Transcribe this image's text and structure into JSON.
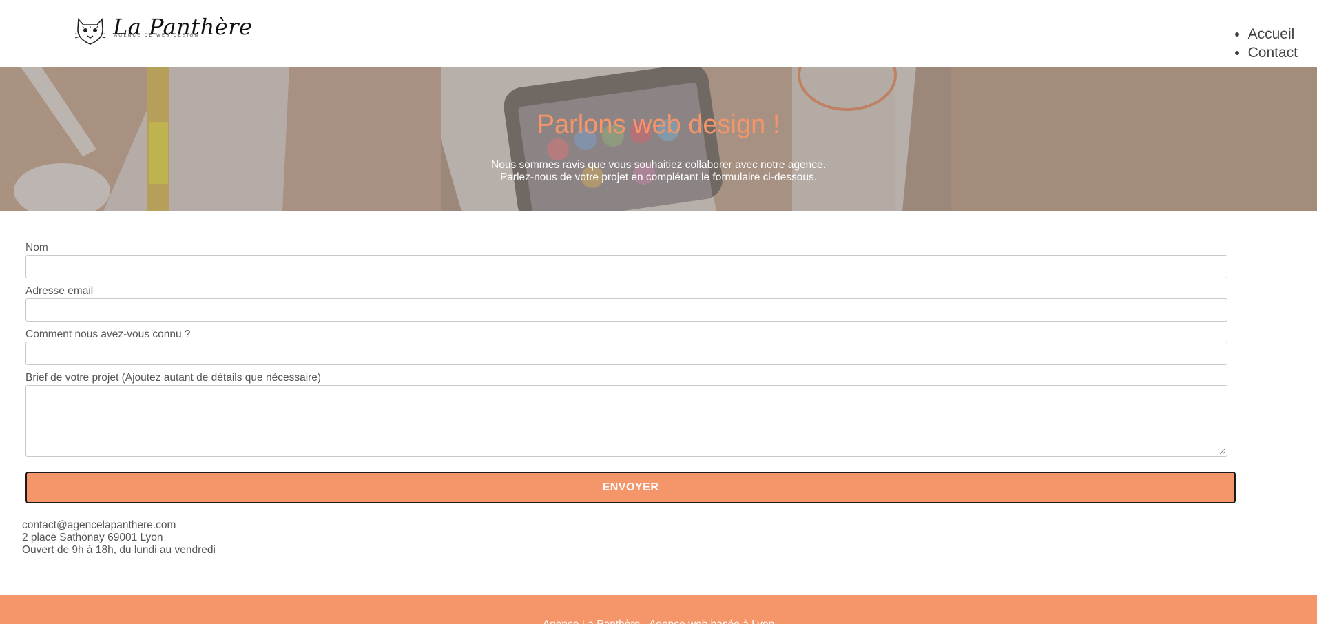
{
  "brand": {
    "name": "La Panthère",
    "tagline": "AGENCE DE WEB DESIGN"
  },
  "nav": {
    "items": [
      {
        "label": "Accueil"
      },
      {
        "label": "Contact"
      }
    ]
  },
  "hero": {
    "title": "Parlons web design !",
    "line1": "Nous sommes ravis que vous souhaitiez collaborer avec notre agence.",
    "line2": "Parlez-nous de votre projet en complétant le formulaire ci-dessous."
  },
  "form": {
    "name_label": "Nom",
    "name_value": "",
    "email_label": "Adresse email",
    "email_value": "",
    "source_label": "Comment nous avez-vous connu ?",
    "source_value": "",
    "brief_label": "Brief de votre projet (Ajoutez autant de détails que nécessaire)",
    "brief_value": "",
    "submit_label": "ENVOYER"
  },
  "contact": {
    "email": "contact@agencelapanthere.com",
    "address": "2 place Sathonay 69001 Lyon",
    "hours": "Ouvert de 9h à 18h, du lundi au vendredi"
  },
  "footer": {
    "text": "Agence La Panthère - Agence web basée à Lyon"
  },
  "colors": {
    "accent": "#f4956a",
    "text": "#555555",
    "hero_overlay": "#9d8f86"
  }
}
